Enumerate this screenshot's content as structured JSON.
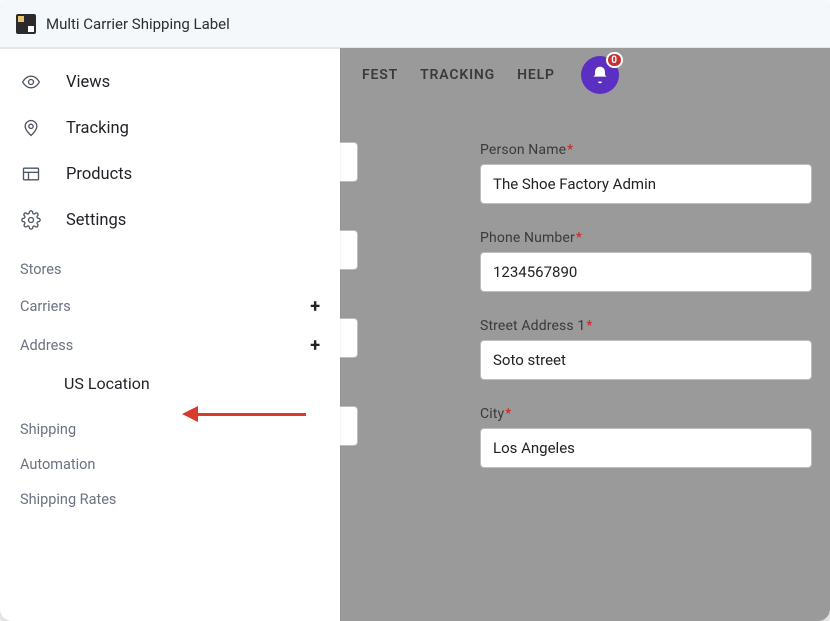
{
  "app": {
    "title": "Multi Carrier Shipping Label"
  },
  "sidebar": {
    "main": [
      {
        "label": "Views",
        "icon": "eye-icon"
      },
      {
        "label": "Tracking",
        "icon": "pin-icon"
      },
      {
        "label": "Products",
        "icon": "layout-icon"
      },
      {
        "label": "Settings",
        "icon": "gear-icon"
      }
    ],
    "sections": {
      "stores": {
        "label": "Stores"
      },
      "carriers": {
        "label": "Carriers"
      },
      "address": {
        "label": "Address",
        "children": [
          {
            "label": "US Location"
          }
        ]
      },
      "shipping": {
        "label": "Shipping"
      },
      "automation": {
        "label": "Automation"
      },
      "shipping_rates": {
        "label": "Shipping Rates"
      }
    }
  },
  "topnav": {
    "items": [
      {
        "label": "FEST"
      },
      {
        "label": "TRACKING"
      },
      {
        "label": "HELP"
      }
    ],
    "notification_count": "0"
  },
  "form": {
    "person_name": {
      "label": "Person Name",
      "required": "*",
      "value": "The Shoe Factory Admin"
    },
    "phone_number": {
      "label": "Phone Number",
      "required": "*",
      "value": "1234567890"
    },
    "street_address1": {
      "label": "Street Address 1",
      "required": "*",
      "value": "Soto street"
    },
    "city": {
      "label": "City",
      "required": "*",
      "value": "Los Angeles"
    }
  },
  "annotation": {
    "target": "US Location"
  }
}
